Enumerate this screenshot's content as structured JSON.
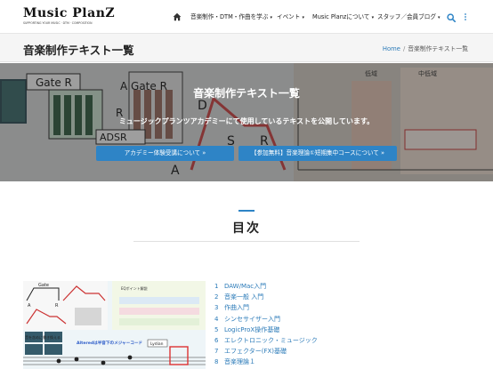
{
  "header": {
    "logo": "Music PlanZ",
    "tagline": "SUPPORTING YOUR MUSIC · DTM · COMPOSITION",
    "nav": [
      {
        "label": "音楽制作・DTM・作曲を学ぶ"
      },
      {
        "label": "イベント"
      },
      {
        "label": "Music Planzについて"
      },
      {
        "label": "スタッフ／会員ブログ"
      }
    ]
  },
  "titlebar": {
    "title": "音楽制作テキスト一覧",
    "breadcrumb_home": "Home",
    "breadcrumb_sep": "/",
    "breadcrumb_current": "音楽制作テキスト一覧"
  },
  "hero": {
    "title": "音楽制作テキスト一覧",
    "subtitle": "ミュージックプランツアカデミーにて使用しているテキストを公開しています。",
    "buttons": [
      {
        "label": "アカデミー体験受講について  »"
      },
      {
        "label": "【参加無料】音楽理論①短期集中コースについて  »"
      }
    ],
    "diagram_labels": {
      "gate_r": "Gate R",
      "a_gate_r": "A Gate R",
      "adsr": "ADSR",
      "a": "A",
      "d": "D",
      "s": "S",
      "r": "R",
      "kaiiki": "低域",
      "chuiki": "中低域"
    }
  },
  "toc": {
    "heading": "目次",
    "items": [
      {
        "num": "1",
        "label": "DAW/Mac入門"
      },
      {
        "num": "2",
        "label": "音楽一般 入門"
      },
      {
        "num": "3",
        "label": "作曲入門"
      },
      {
        "num": "4",
        "label": "シンセサイザー入門"
      },
      {
        "num": "5",
        "label": "LogicProX操作基礎"
      },
      {
        "num": "6",
        "label": "エレクトロニック・ミュージック"
      },
      {
        "num": "7",
        "label": "エフェクター(FX)基礎"
      },
      {
        "num": "8",
        "label": "音楽理論１"
      }
    ],
    "thumb_labels": {
      "gate": "Gate",
      "a": "A",
      "r": "R",
      "eq": "EQポイント解説",
      "altered": "Alteredは半音下のメジャーコード",
      "lydian": "Lydian",
      "kaeru": "音を含めに書き換える"
    }
  },
  "colors": {
    "accent": "#2e84c6",
    "link": "#2a7ab8"
  },
  "icons": [
    "home-icon",
    "search-icon",
    "more-vertical-icon",
    "chevron-right-icon"
  ]
}
